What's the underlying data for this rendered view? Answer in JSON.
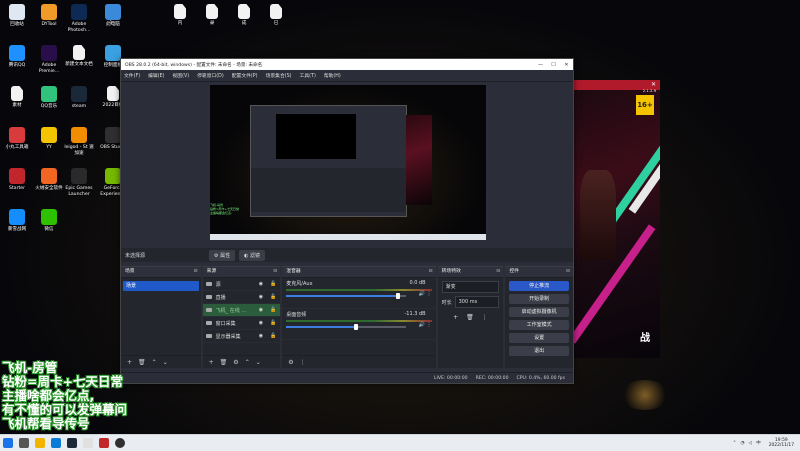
{
  "desktop": {
    "icons": [
      {
        "label": "回收站",
        "color": "#dfe8f2"
      },
      {
        "label": "DYTool",
        "color": "#f09a2a"
      },
      {
        "label": "Adobe Photosh...",
        "color": "#0d2a55"
      },
      {
        "label": "1",
        "color": "#f2f2f2"
      },
      {
        "label": "此电脑",
        "color": "#3b8ad9"
      },
      {
        "label": "腾讯QQ",
        "color": "#1e90ff"
      },
      {
        "label": "Adobe Premie...",
        "color": "#2a0e4a"
      },
      {
        "label": "新建文本文档",
        "color": "#f2f2f2"
      },
      {
        "label": "控制面板",
        "color": "#3aa0e0"
      },
      {
        "label": "素材",
        "color": "#f2f2f2"
      },
      {
        "label": "QQ音乐",
        "color": "#31c27c"
      },
      {
        "label": "steam",
        "color": "#1b2838"
      },
      {
        "label": "2022目标",
        "color": "#f2f2f2"
      },
      {
        "label": "小丸工具箱",
        "color": "#d83b3b"
      },
      {
        "label": "YY",
        "color": "#f5c400"
      },
      {
        "label": "leigod - St 速加速",
        "color": "#f28c00"
      },
      {
        "label": "OBS Studio",
        "color": "#302e31"
      },
      {
        "label": "Starter",
        "color": "#c0262c"
      },
      {
        "label": "火绒安全软件",
        "color": "#f26522"
      },
      {
        "label": "Epic Games Launcher",
        "color": "#2a2a2a"
      },
      {
        "label": "GeForce Experience",
        "color": "#76b900"
      },
      {
        "label": "暴雪战网",
        "color": "#148eff"
      },
      {
        "label": "微信",
        "color": "#2dc100"
      }
    ],
    "top_files": [
      "内",
      "录",
      "成",
      "已"
    ]
  },
  "game": {
    "badge": "16+",
    "version": "2.1.2.9",
    "logo_text": "战"
  },
  "obs": {
    "title": "OBS 28.0.2 (64-bit, windows) - 配置文件: 未命名 - 场景: 未命名",
    "menu": [
      "文件(F)",
      "编辑(E)",
      "视图(V)",
      "停靠窗口(D)",
      "配置文件(P)",
      "场景集合(S)",
      "工具(T)",
      "帮助(H)"
    ],
    "preview_toolbar": {
      "no_source": "未选择源",
      "properties": "属性",
      "filters": "滤镜"
    },
    "scenes": {
      "title": "场景",
      "items": [
        "场景"
      ]
    },
    "sources": {
      "title": "来源",
      "items": [
        {
          "label": "源"
        },
        {
          "label": "直播"
        },
        {
          "label": "飞机_ 在线 ..."
        },
        {
          "label": "窗口采集"
        },
        {
          "label": "显示器采集"
        }
      ]
    },
    "mixer": {
      "title": "混音器",
      "channels": [
        {
          "name": "麦克风/Aux",
          "db": "0.0 dB",
          "level": 0.93
        },
        {
          "name": "桌面音频",
          "db": "-11.3 dB",
          "level": 0.58
        }
      ]
    },
    "transitions": {
      "title": "转场特效",
      "selected": "渐变",
      "duration_label": "时长",
      "duration": "300 ms"
    },
    "controls": {
      "title": "控件",
      "buttons": [
        "停止推流",
        "开始录制",
        "启动虚拟摄像机",
        "工作室模式",
        "设置",
        "退出"
      ]
    },
    "status": {
      "live": "LIVE: 00:00:00",
      "rec": "REC: 00:00:00",
      "cpu": "CPU: 0.4%, 60.00 fps"
    }
  },
  "overlay_text": [
    "飞机-房管",
    "钻粉=周卡+七天日常",
    "主播啥都会亿点,",
    "有不懂的可以发弹幕问",
    "飞机帮看导传号"
  ],
  "taskbar": {
    "time": "19:59",
    "date": "2022/11/17",
    "input_lang": "中"
  }
}
